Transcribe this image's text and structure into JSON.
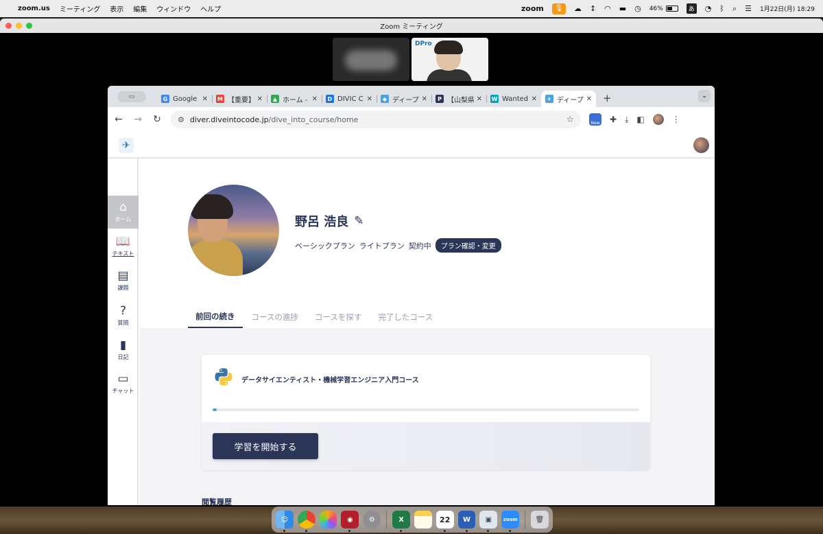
{
  "menubar": {
    "app_name": "zoom.us",
    "menus": [
      "ミーティング",
      "表示",
      "編集",
      "ウィンドウ",
      "ヘルプ"
    ],
    "zoom_label": "zoom",
    "battery": "46%",
    "ime": "あ",
    "datetime": "1月22日(月)  18:29"
  },
  "zoom_window": {
    "title": "Zoom ミーティング",
    "thumb_logo": "DPro"
  },
  "browser": {
    "tabs": [
      {
        "label": "Google",
        "fav": "G",
        "color": "#4285f4"
      },
      {
        "label": "【重要】",
        "fav": "M",
        "color": "#ea4335"
      },
      {
        "label": "ホーム -",
        "fav": "▲",
        "color": "#34a853"
      },
      {
        "label": "DIVIC C",
        "fav": "D",
        "color": "#1a73e8"
      },
      {
        "label": "ディープ",
        "fav": "◆",
        "color": "#4aa3df"
      },
      {
        "label": "【山梨県",
        "fav": "P",
        "color": "#2a3558"
      },
      {
        "label": "Wanted",
        "fav": "W",
        "color": "#00a4bd"
      },
      {
        "label": "ディープ",
        "fav": "✈",
        "color": "#4aa3df"
      }
    ],
    "tab_close": "✕",
    "new_tab": "+",
    "url_host": "diver.diveintocode.jp",
    "url_path": "/dive_into_course/home",
    "new_badge": "New"
  },
  "sidebar": {
    "items": [
      {
        "label": "ホーム",
        "icon": "home-icon"
      },
      {
        "label": "テキスト",
        "icon": "book-icon"
      },
      {
        "label": "課題",
        "icon": "clipboard-icon"
      },
      {
        "label": "質問",
        "icon": "question-icon"
      },
      {
        "label": "日記",
        "icon": "diary-icon"
      },
      {
        "label": "チャット",
        "icon": "chat-icon"
      }
    ]
  },
  "profile": {
    "name": "野呂 浩良",
    "plan_basic": "ベーシックプラン",
    "plan_lite": "ライトプラン",
    "plan_status": "契約中",
    "plan_button": "プラン確認・変更"
  },
  "course_tabs": [
    "前回の続き",
    "コースの進捗",
    "コースを探す",
    "完了したコース"
  ],
  "course": {
    "title": "データサイエンティスト・機械学習エンジニア入門コース",
    "progress": 0.01,
    "start_button": "学習を開始する"
  },
  "history_title": "閲覧履歴",
  "dock": {
    "calendar_day": "22",
    "zoom_label": "zoom"
  },
  "colors": {
    "navy": "#2a3558",
    "accent_orange": "#f39a1b",
    "progress": "#5aa0c8"
  }
}
